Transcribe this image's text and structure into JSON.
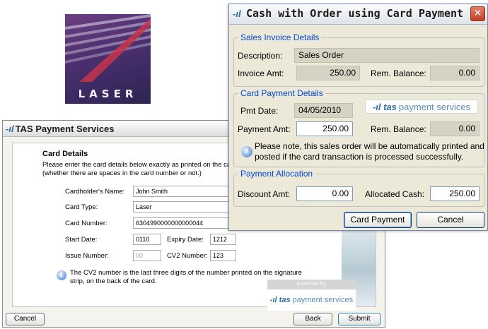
{
  "logo": {
    "word": "LASER"
  },
  "tas_window": {
    "title": "TAS Payment Services",
    "heading": "Card Details",
    "instructions": "Please enter the card details below exactly as printed on the card (whether there are spaces in the card number or not.)",
    "fields": {
      "cardholder_label": "Cardholder's Name:",
      "cardholder_value": "John Smith",
      "card_type_label": "Card Type:",
      "card_type_value": "Laser",
      "card_number_label": "Card Number:",
      "card_number_value": "6304990000000000044",
      "start_label": "Start Date:",
      "start_value": "0110",
      "expiry_label": "Expiry Date:",
      "expiry_value": "1212",
      "issue_label": "Issue Number:",
      "issue_placeholder": "00",
      "cv2_label": "CV2 Number:",
      "cv2_value": "123"
    },
    "cv2_note": "The CV2 number is the last three digits of the number printed on the signature strip, on the back of the card.",
    "powered_by": "powered by",
    "brand_name": "payment services",
    "brand_mark": "-ıl tas",
    "buttons": {
      "cancel": "Cancel",
      "back": "Back",
      "submit": "Submit"
    }
  },
  "dialog": {
    "title": "Cash with Order using Card Payment",
    "invoice_group": {
      "title": "Sales Invoice Details",
      "description_label": "Description:",
      "description_value": "Sales Order",
      "invoice_amt_label": "Invoice Amt:",
      "invoice_amt_value": "250.00",
      "rem_balance_label": "Rem. Balance:",
      "rem_balance_value": "0.00"
    },
    "card_group": {
      "title": "Card Payment Details",
      "pmt_date_label": "Pmt Date:",
      "pmt_date_value": "04/05/2010",
      "payment_amt_label": "Payment Amt:",
      "payment_amt_value": "250.00",
      "rem_balance_label": "Rem. Balance:",
      "rem_balance_value": "0.00",
      "brand_mark": "-ıl tas",
      "brand_name": "payment services",
      "note": "Please note, this sales order will be automatically printed and posted if the card transaction is processed successfully."
    },
    "allocation_group": {
      "title": "Payment Allocation",
      "discount_label": "Discount Amt:",
      "discount_value": "0.00",
      "allocated_label": "Allocated Cash:",
      "allocated_value": "250.00"
    },
    "buttons": {
      "card_payment": "Card Payment",
      "cancel": "Cancel"
    },
    "close_glyph": "✕"
  }
}
